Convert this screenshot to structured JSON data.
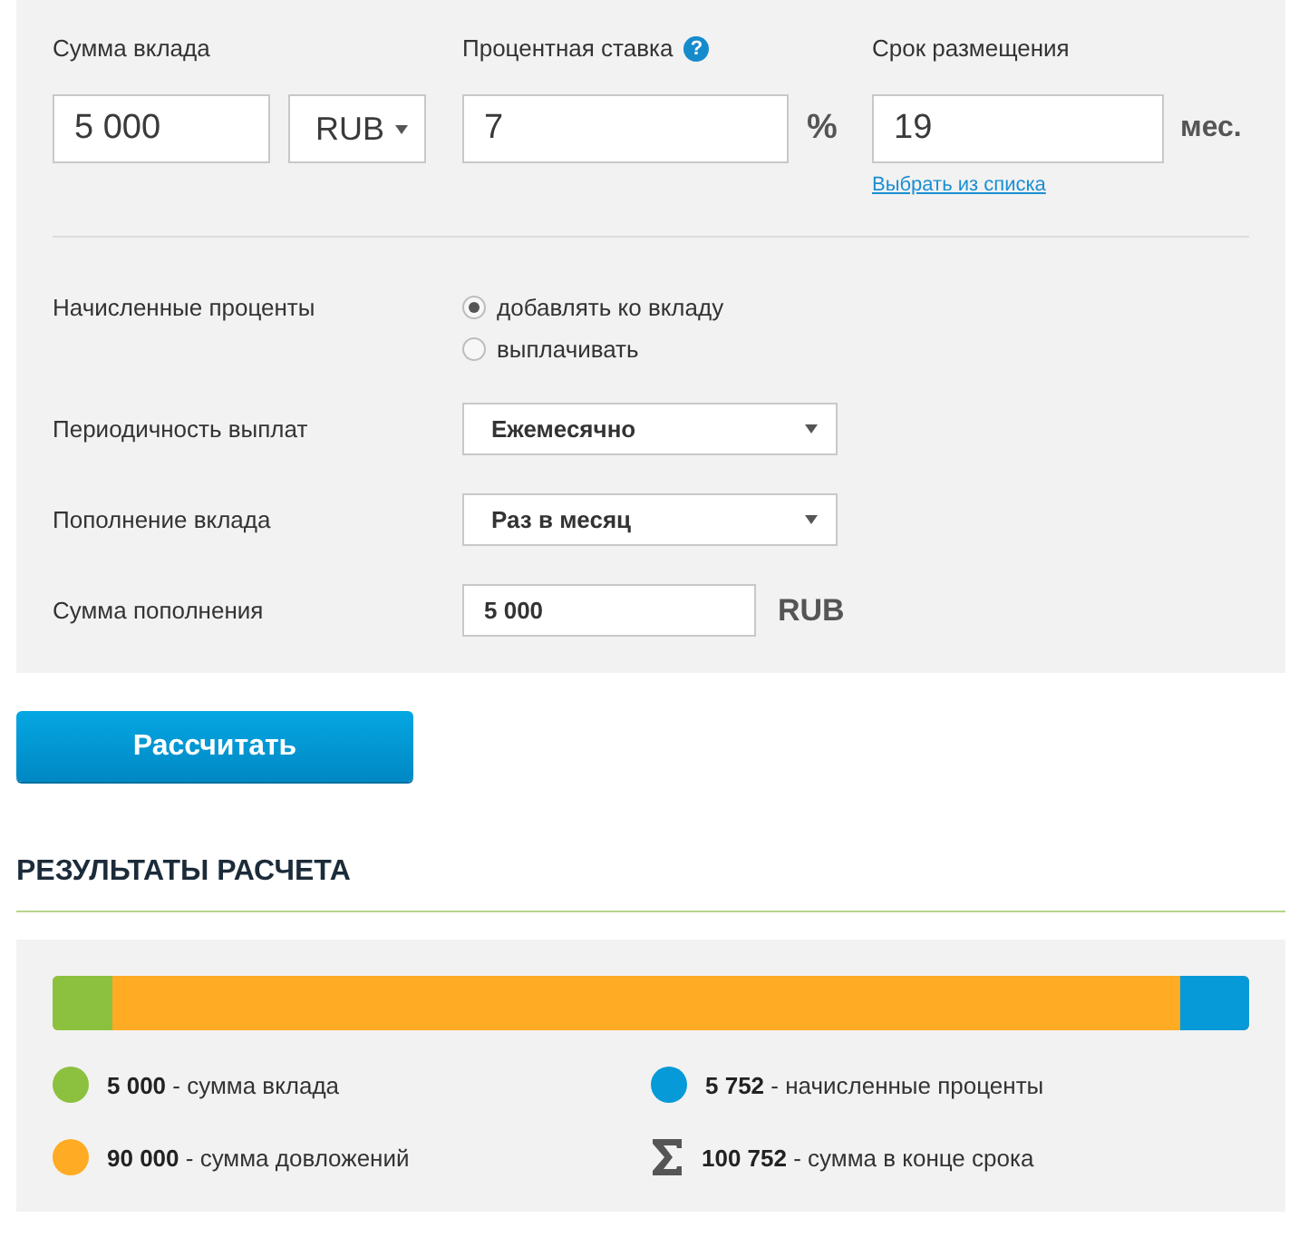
{
  "deposit_form": {
    "amount": {
      "label": "Сумма вклада",
      "value": "5 000",
      "currency": "RUB"
    },
    "rate": {
      "label": "Процентная ставка",
      "hint": "?",
      "value": "7",
      "unit": "%"
    },
    "term": {
      "label": "Срок размещения",
      "value": "19",
      "unit": "мес.",
      "link": "Выбрать из списка"
    },
    "options": [
      {
        "kind": "radio",
        "label": "Начисленные проценты",
        "choices": [
          {
            "label": "добавлять ко вкладу",
            "selected": true
          },
          {
            "label": "выплачивать",
            "selected": false
          }
        ]
      },
      {
        "kind": "select",
        "label": "Периодичность выплат",
        "value": "Ежемесячно"
      },
      {
        "kind": "select",
        "label": "Пополнение вклада",
        "value": "Раз в месяц"
      },
      {
        "kind": "input",
        "label": "Сумма пополнения",
        "value": "5 000",
        "unit": "RUB"
      }
    ]
  },
  "calculate_button": "Рассчитать",
  "results": {
    "title": "РЕЗУЛЬТАТЫ РАСЧЕТА",
    "bar": {
      "color": "#ffab24",
      "fills": [
        {
          "kind": "start",
          "level": 0.05,
          "color": "#8cc13f"
        },
        {
          "kind": "end",
          "level": 0.057,
          "color": "#069ad8"
        }
      ]
    },
    "legend": [
      {
        "kind": "dot",
        "text": "**5 000** - сумма вклада",
        "color": "#8cc13f"
      },
      {
        "kind": "dot",
        "text": "**5 752** - начисленные проценты",
        "color": "#069ad8"
      },
      {
        "kind": "dot",
        "text": "**90 000** - сумма довложений",
        "color": "#ffab24"
      },
      {
        "kind": "sum",
        "text": "**100 752** - сумма в конце срока"
      }
    ]
  }
}
